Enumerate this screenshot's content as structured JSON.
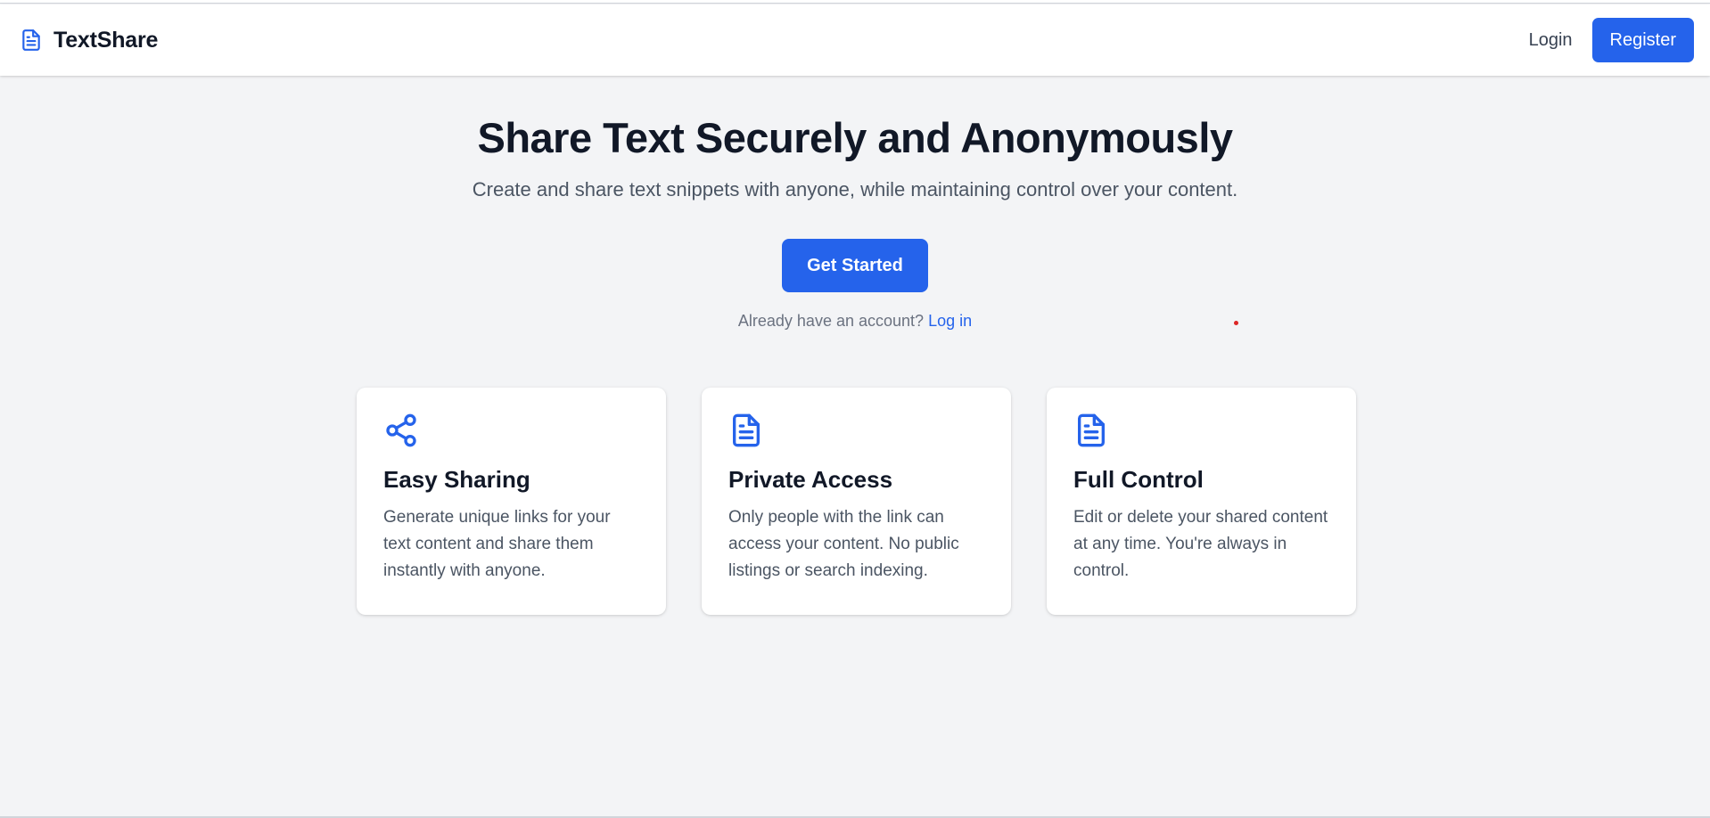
{
  "colors": {
    "accent": "#2563eb",
    "background": "#f3f4f6",
    "card_background": "#ffffff",
    "heading": "#111827",
    "muted_text": "#4b5563",
    "dot": "#dc2626"
  },
  "navbar": {
    "brand_icon": "document-icon",
    "brand_name": "TextShare",
    "login_label": "Login",
    "register_label": "Register"
  },
  "hero": {
    "title": "Share Text Securely and Anonymously",
    "subtitle": "Create and share text snippets with anyone, while maintaining control over your content.",
    "cta_label": "Get Started",
    "login_prompt": "Already have an account?",
    "login_link": "Log in"
  },
  "features": [
    {
      "icon": "share-icon",
      "title": "Easy Sharing",
      "text": "Generate unique links for your text content and share them instantly with anyone."
    },
    {
      "icon": "document-icon",
      "title": "Private Access",
      "text": "Only people with the link can access your content. No public listings or search indexing."
    },
    {
      "icon": "document-icon",
      "title": "Full Control",
      "text": "Edit or delete your shared content at any time. You're always in control."
    }
  ]
}
